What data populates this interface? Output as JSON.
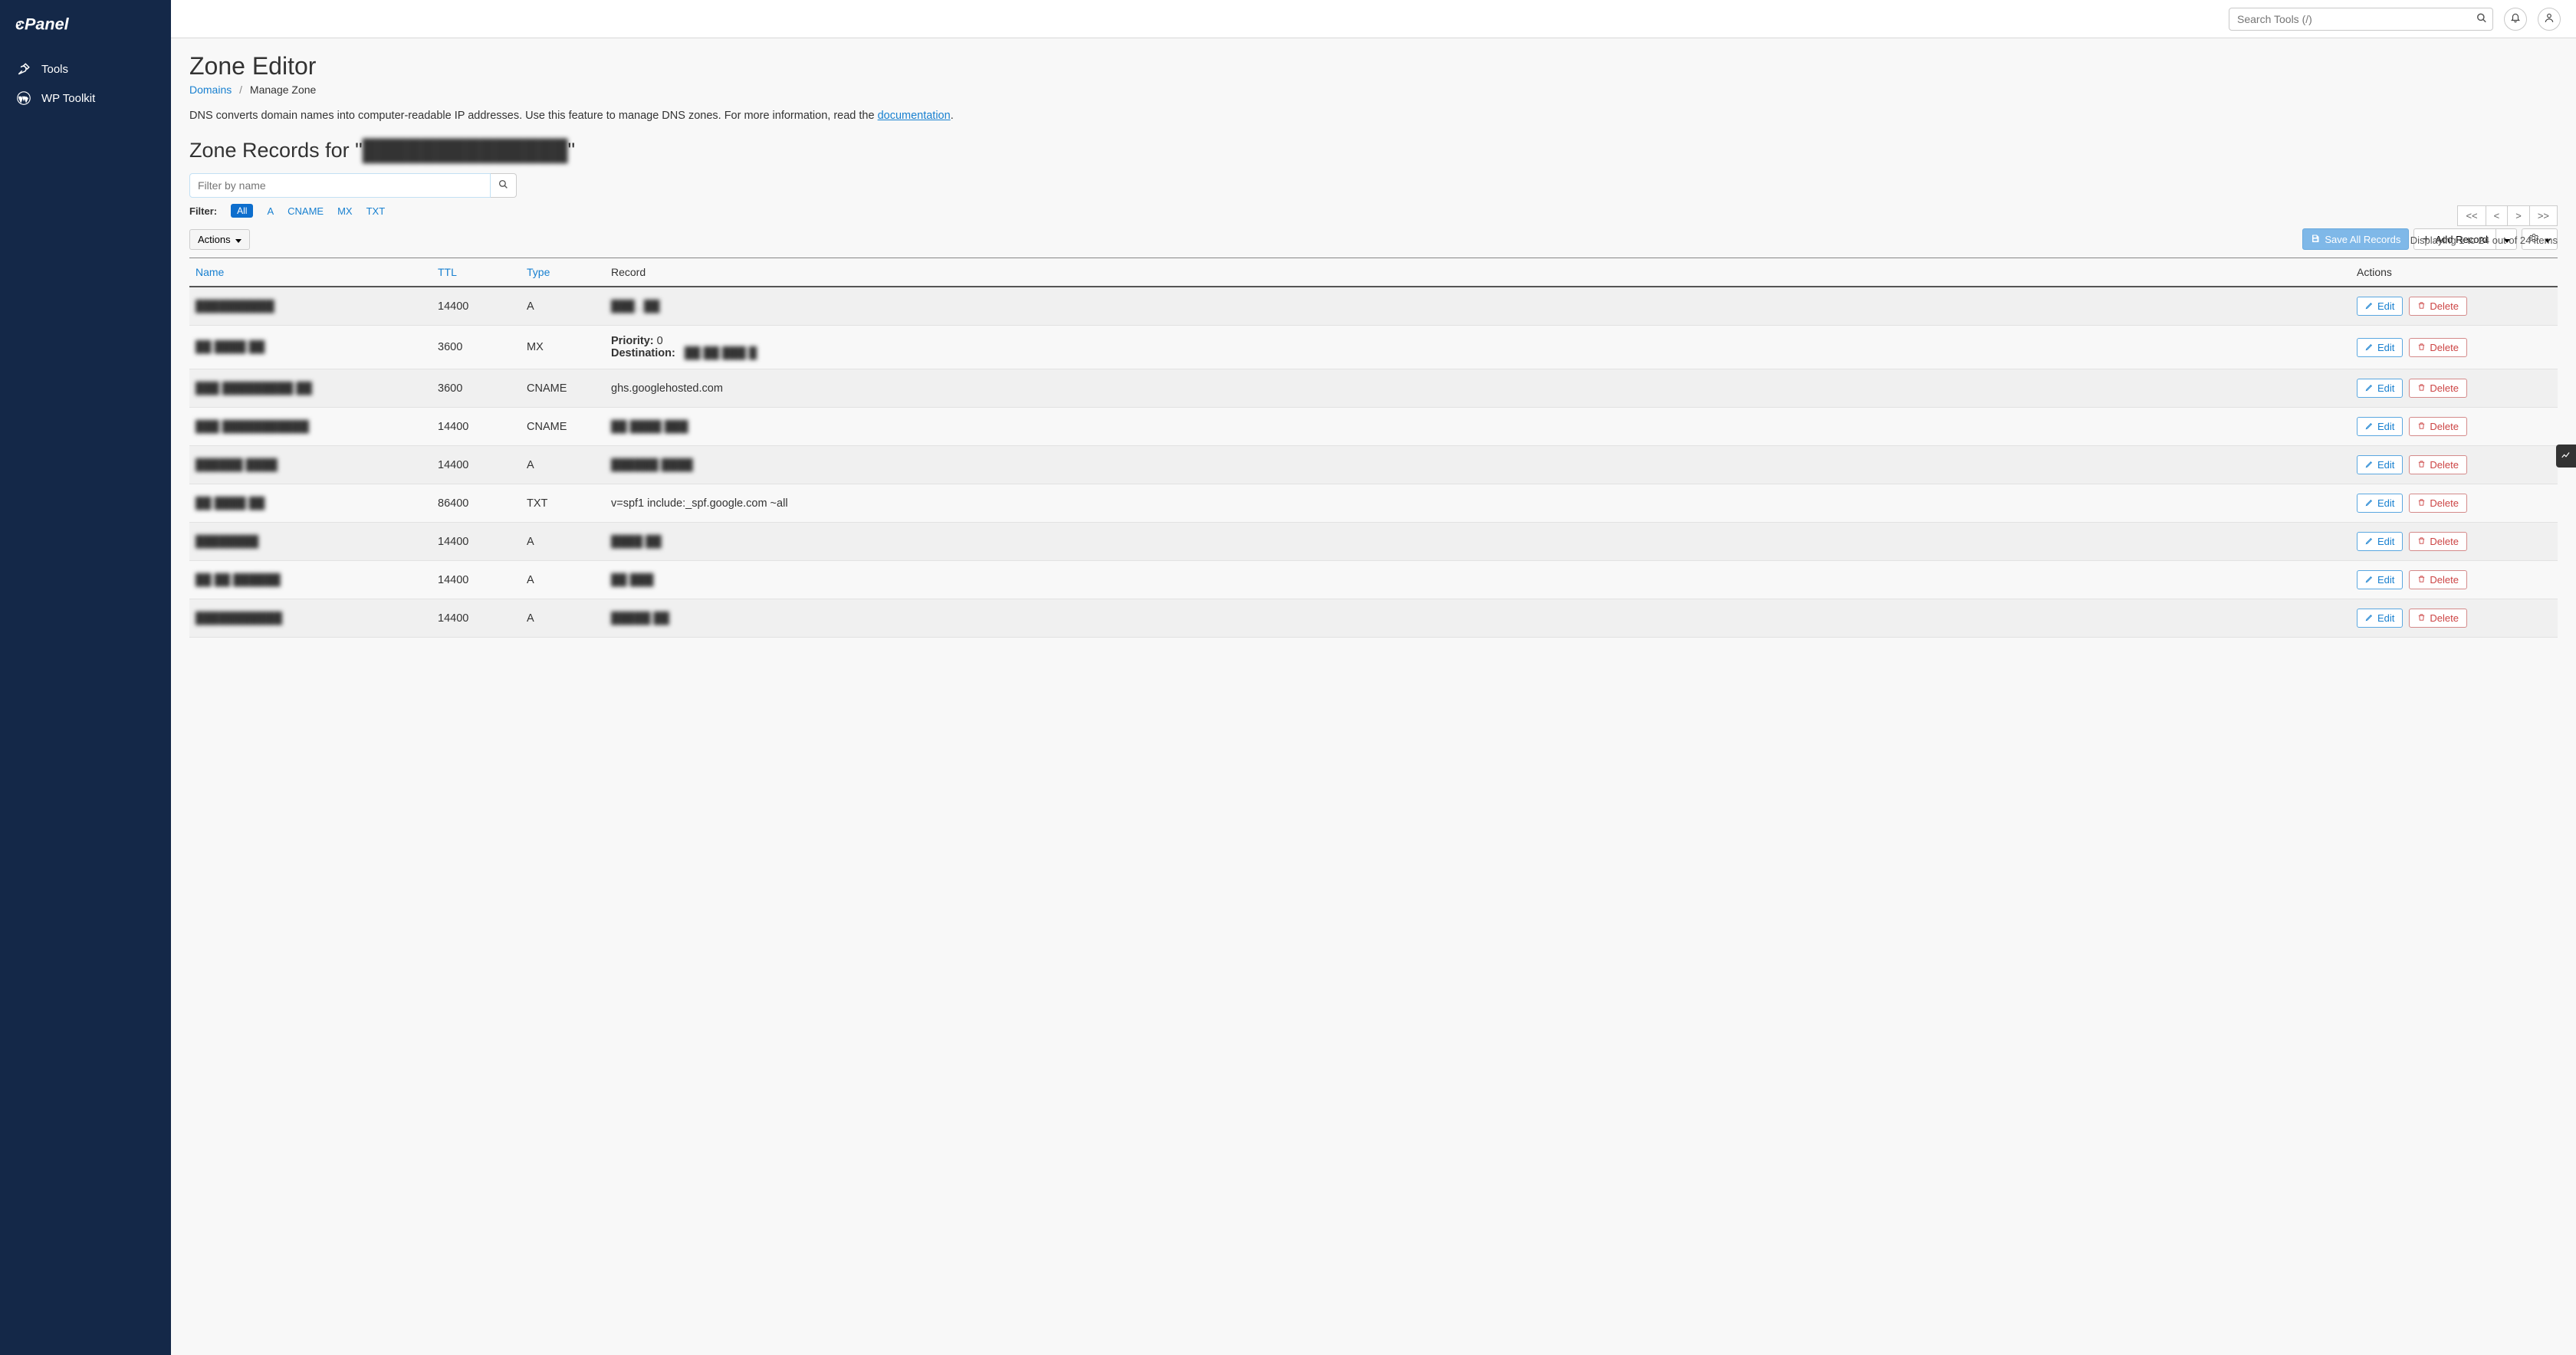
{
  "sidebar": {
    "items": [
      {
        "label": "Tools",
        "icon": "wrench-screwdriver"
      },
      {
        "label": "WP Toolkit",
        "icon": "wordpress"
      }
    ]
  },
  "topbar": {
    "search_placeholder": "Search Tools (/)"
  },
  "page": {
    "title": "Zone Editor",
    "breadcrumb_domains": "Domains",
    "breadcrumb_current": "Manage Zone",
    "description_pre": "DNS converts domain names into computer-readable IP addresses. Use this feature to manage DNS zones. For more information, read the ",
    "description_link": "documentation",
    "description_post": ".",
    "subtitle_pre": "Zone Records for \"",
    "subtitle_domain": "██████████████",
    "subtitle_post": "\""
  },
  "filter": {
    "placeholder": "Filter by name",
    "label": "Filter:",
    "all": "All",
    "types": [
      "A",
      "CNAME",
      "MX",
      "TXT"
    ]
  },
  "pager": {
    "first": "<<",
    "prev": "<",
    "next": ">",
    "last": ">>",
    "displaying": "Displaying 1 to 24 out of 24 items"
  },
  "actions": {
    "dropdown": "Actions",
    "save_all": "Save All Records",
    "add_record": "Add Record"
  },
  "table": {
    "headers": {
      "name": "Name",
      "ttl": "TTL",
      "type": "Type",
      "record": "Record",
      "actions": "Actions"
    },
    "edit": "Edit",
    "delete": "Delete",
    "priority_label": "Priority:",
    "destination_label": "Destination:",
    "rows": [
      {
        "name": "██████████",
        "ttl": "14400",
        "type": "A",
        "record": "███ . ██",
        "odd": true
      },
      {
        "name": "██ ████ ██",
        "ttl": "3600",
        "type": "MX",
        "record": "",
        "priority": "0",
        "destination": "██ ██ ███ █",
        "odd": false
      },
      {
        "name": "███ █████████ ██",
        "ttl": "3600",
        "type": "CNAME",
        "record": "ghs.googlehosted.com",
        "odd": true
      },
      {
        "name": "███ ███████████",
        "ttl": "14400",
        "type": "CNAME",
        "record": "██ ████ ███",
        "odd": false
      },
      {
        "name": "██████ ████",
        "ttl": "14400",
        "type": "A",
        "record": "██████ ████",
        "odd": true
      },
      {
        "name": "██ ████ ██",
        "ttl": "86400",
        "type": "TXT",
        "record": "v=spf1 include:_spf.google.com ~all",
        "odd": false
      },
      {
        "name": "████████",
        "ttl": "14400",
        "type": "A",
        "record": "████ ██",
        "odd": true
      },
      {
        "name": "██ ██ ██████",
        "ttl": "14400",
        "type": "A",
        "record": "██ ███",
        "odd": false
      },
      {
        "name": "███████████",
        "ttl": "14400",
        "type": "A",
        "record": "█████ ██",
        "odd": true
      }
    ]
  }
}
